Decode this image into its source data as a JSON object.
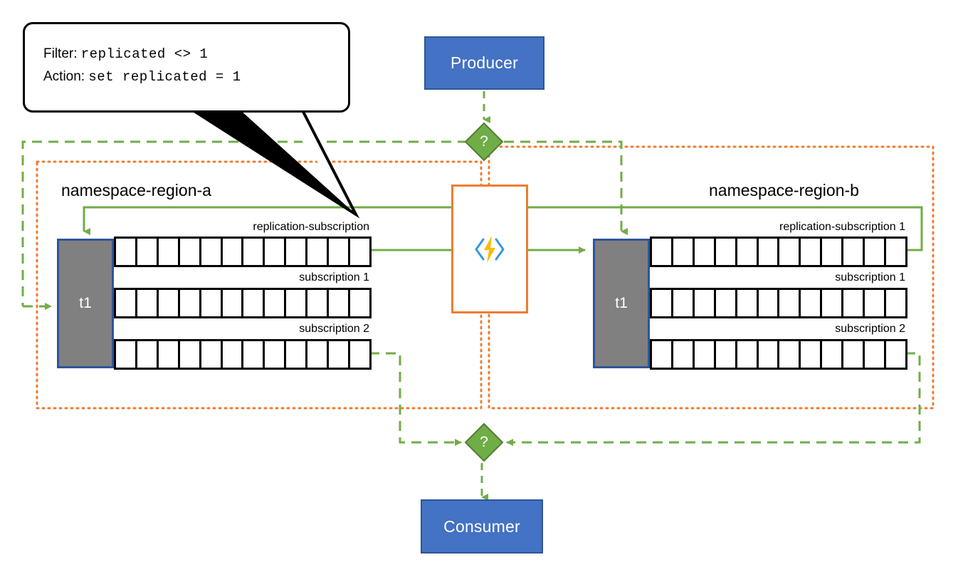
{
  "diagram": {
    "title": "Azure Service Bus geo-replication with filter/action topic replication",
    "colors": {
      "node_fill": "#4472C4",
      "node_border": "#2F5597",
      "topic_fill": "#808080",
      "accent_green": "#70AD47",
      "accent_orange": "#ED7D31",
      "queue_border": "#000000",
      "bolt_yellow": "#FFB900",
      "bracket_blue": "#3A96DD"
    }
  },
  "callout": {
    "name": "filter-action-callout",
    "lines": [
      {
        "label": "Filter:",
        "value": "replicated <> 1"
      },
      {
        "label": "Action:",
        "value": "set replicated = 1"
      }
    ]
  },
  "producer": {
    "label": "Producer"
  },
  "consumer": {
    "label": "Consumer"
  },
  "function": {
    "icon": "azure-function-bolt-icon"
  },
  "decision_nodes": [
    {
      "name": "decision-top",
      "label": "?"
    },
    {
      "name": "decision-bottom",
      "label": "?"
    }
  ],
  "namespaces": [
    {
      "name": "namespace-region-a",
      "title": "namespace-region-a",
      "topic": {
        "label": "t1"
      },
      "subscriptions": [
        {
          "label": "replication-subscription",
          "cells": 12
        },
        {
          "label": "subscription 1",
          "cells": 12
        },
        {
          "label": "subscription 2",
          "cells": 12
        }
      ]
    },
    {
      "name": "namespace-region-b",
      "title": "namespace-region-b",
      "topic": {
        "label": "t1"
      },
      "subscriptions": [
        {
          "label": "replication-subscription 1",
          "cells": 12
        },
        {
          "label": "subscription 1",
          "cells": 12
        },
        {
          "label": "subscription 2",
          "cells": 12
        }
      ]
    }
  ]
}
